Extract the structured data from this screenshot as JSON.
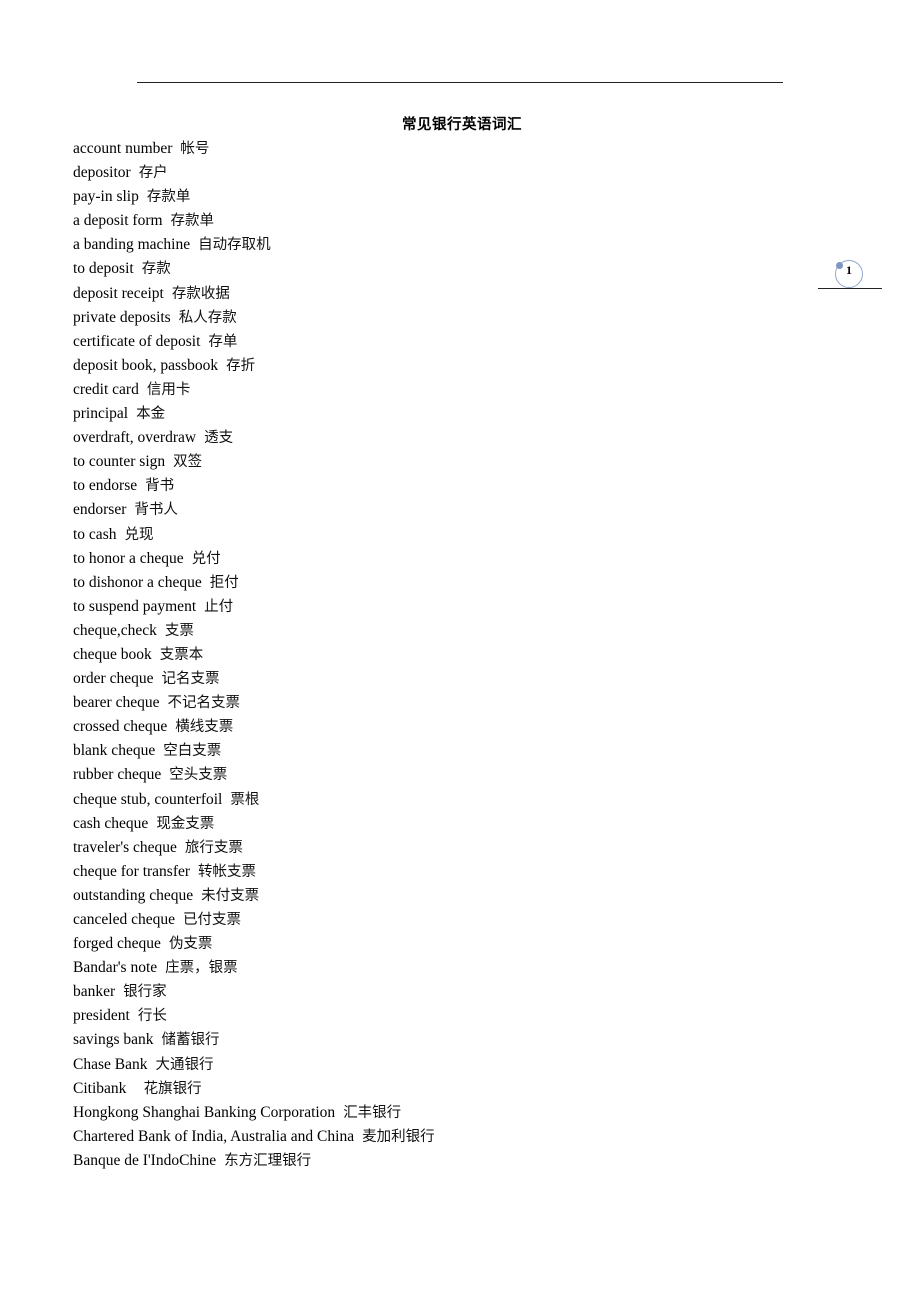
{
  "document": {
    "title": "常见银行英语词汇",
    "page_number": "1"
  },
  "entries": [
    {
      "en": "account number",
      "zh": "帐号"
    },
    {
      "en": "depositor",
      "zh": "存户"
    },
    {
      "en": "pay-in slip",
      "zh": "存款单"
    },
    {
      "en": "a deposit form",
      "zh": "存款单"
    },
    {
      "en": "a banding machine",
      "zh": "自动存取机"
    },
    {
      "en": "to deposit",
      "zh": "存款"
    },
    {
      "en": "deposit receipt",
      "zh": "存款收据"
    },
    {
      "en": "private deposits",
      "zh": "私人存款"
    },
    {
      "en": "certificate of deposit",
      "zh": "存单"
    },
    {
      "en": "deposit book, passbook",
      "zh": "存折"
    },
    {
      "en": "credit card",
      "zh": "信用卡"
    },
    {
      "en": "principal",
      "zh": "本金"
    },
    {
      "en": "overdraft, overdraw",
      "zh": "透支"
    },
    {
      "en": "to counter sign",
      "zh": "双签"
    },
    {
      "en": "to endorse",
      "zh": "背书"
    },
    {
      "en": "endorser",
      "zh": "背书人"
    },
    {
      "en": "to cash",
      "zh": "兑现"
    },
    {
      "en": "to honor a cheque",
      "zh": "兑付"
    },
    {
      "en": "to dishonor a cheque",
      "zh": "拒付"
    },
    {
      "en": "to suspend payment",
      "zh": "止付"
    },
    {
      "en": "cheque,check",
      "zh": "支票"
    },
    {
      "en": "cheque book",
      "zh": "支票本"
    },
    {
      "en": "order cheque",
      "zh": "记名支票"
    },
    {
      "en": "bearer cheque",
      "zh": "不记名支票"
    },
    {
      "en": "crossed cheque",
      "zh": "横线支票"
    },
    {
      "en": "blank cheque",
      "zh": "空白支票"
    },
    {
      "en": "rubber cheque",
      "zh": "空头支票"
    },
    {
      "en": "cheque stub, counterfoil",
      "zh": "票根"
    },
    {
      "en": "cash cheque",
      "zh": "现金支票"
    },
    {
      "en": "traveler's cheque",
      "zh": "旅行支票"
    },
    {
      "en": "cheque for transfer",
      "zh": "转帐支票"
    },
    {
      "en": "outstanding cheque",
      "zh": "未付支票"
    },
    {
      "en": "canceled cheque",
      "zh": "已付支票"
    },
    {
      "en": "forged cheque",
      "zh": "伪支票"
    },
    {
      "en": "Bandar's note",
      "zh": "庄票，银票"
    },
    {
      "en": "banker",
      "zh": "银行家"
    },
    {
      "en": "president",
      "zh": "行长"
    },
    {
      "en": "savings bank",
      "zh": "储蓄银行"
    },
    {
      "en": "Chase Bank",
      "zh": "大通银行"
    },
    {
      "en": "Citibank",
      "zh": "  花旗银行"
    },
    {
      "en": "Hongkong Shanghai Banking Corporation",
      "zh": "汇丰银行"
    },
    {
      "en": "Chartered Bank of India, Australia and China",
      "zh": "麦加利银行"
    },
    {
      "en": "Banque de I'IndoChine",
      "zh": "东方汇理银行"
    }
  ]
}
